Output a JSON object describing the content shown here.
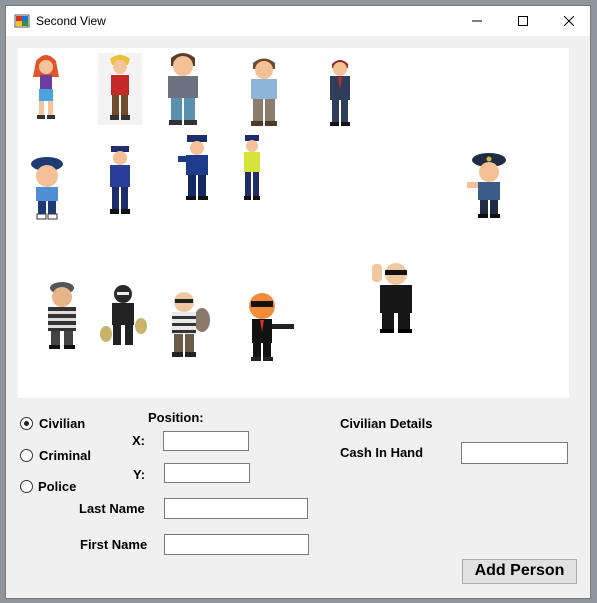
{
  "window": {
    "title": "Second View"
  },
  "characters": [
    {
      "name": "civilian-girl-icon"
    },
    {
      "name": "civilian-boy-icon"
    },
    {
      "name": "civilian-man-icon"
    },
    {
      "name": "civilian-man-2-icon"
    },
    {
      "name": "civilian-businessman-icon"
    },
    {
      "name": "police-kid-icon"
    },
    {
      "name": "police-woman-icon"
    },
    {
      "name": "police-officer-icon"
    },
    {
      "name": "police-traffic-icon"
    },
    {
      "name": "police-chief-icon"
    },
    {
      "name": "criminal-striped-icon"
    },
    {
      "name": "criminal-bags-icon"
    },
    {
      "name": "criminal-robber-icon"
    },
    {
      "name": "criminal-masked-icon"
    },
    {
      "name": "criminal-bodyguard-icon"
    }
  ],
  "form": {
    "type_options": [
      {
        "label": "Civilian",
        "checked": true
      },
      {
        "label": "Criminal",
        "checked": false
      },
      {
        "label": "Police",
        "checked": false
      }
    ],
    "position_label": "Position:",
    "x_label": "X:",
    "y_label": "Y:",
    "x_value": "",
    "y_value": "",
    "last_name_label": "Last Name",
    "last_name_value": "",
    "first_name_label": "First Name",
    "first_name_value": "",
    "details_title": "Civilian Details",
    "cash_label": "Cash In Hand",
    "cash_value": "",
    "add_button": "Add Person"
  }
}
